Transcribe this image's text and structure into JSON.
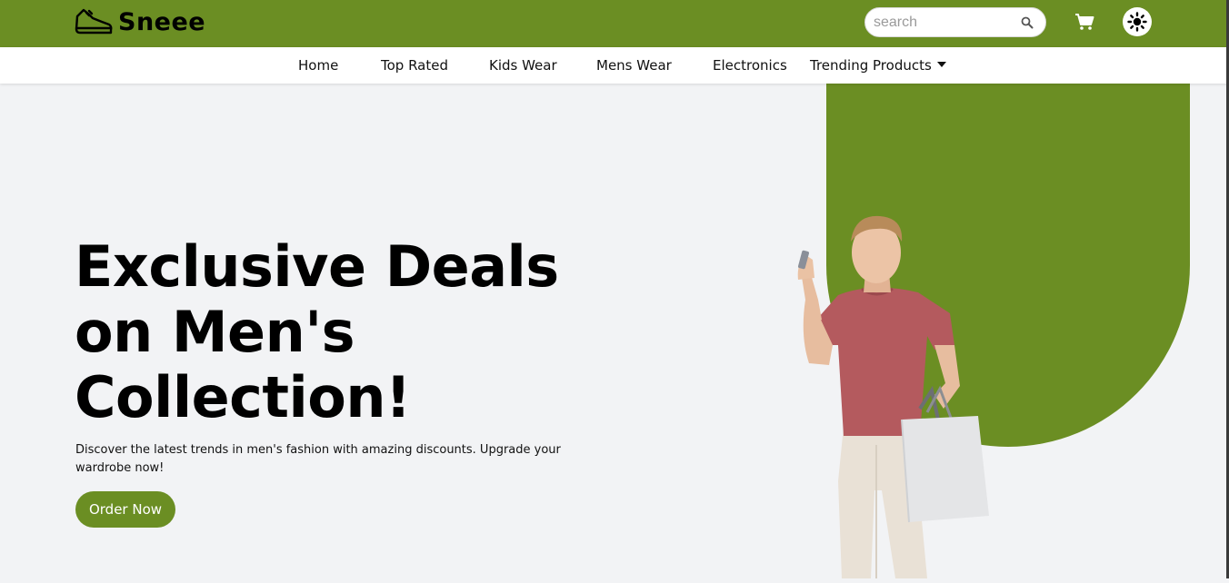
{
  "brand": {
    "name": "Sneee",
    "logo_icon": "shoe-icon",
    "accent_color": "#6b8e23"
  },
  "header": {
    "search": {
      "placeholder": "search",
      "value": "",
      "icon": "search-icon"
    },
    "cart_icon": "cart-icon",
    "theme_toggle_icon": "sun-icon"
  },
  "nav": {
    "items": [
      {
        "label": "Home"
      },
      {
        "label": "Top Rated"
      },
      {
        "label": "Kids Wear"
      },
      {
        "label": "Mens Wear"
      },
      {
        "label": "Electronics"
      },
      {
        "label": "Trending Products",
        "dropdown": true
      }
    ]
  },
  "hero": {
    "title": "Exclusive Deals on Men's Collection!",
    "description": "Discover the latest trends in men's fashion with amazing discounts. Upgrade your wardrobe now!",
    "cta_label": "Order Now",
    "image": "man-with-shopping-bag"
  }
}
